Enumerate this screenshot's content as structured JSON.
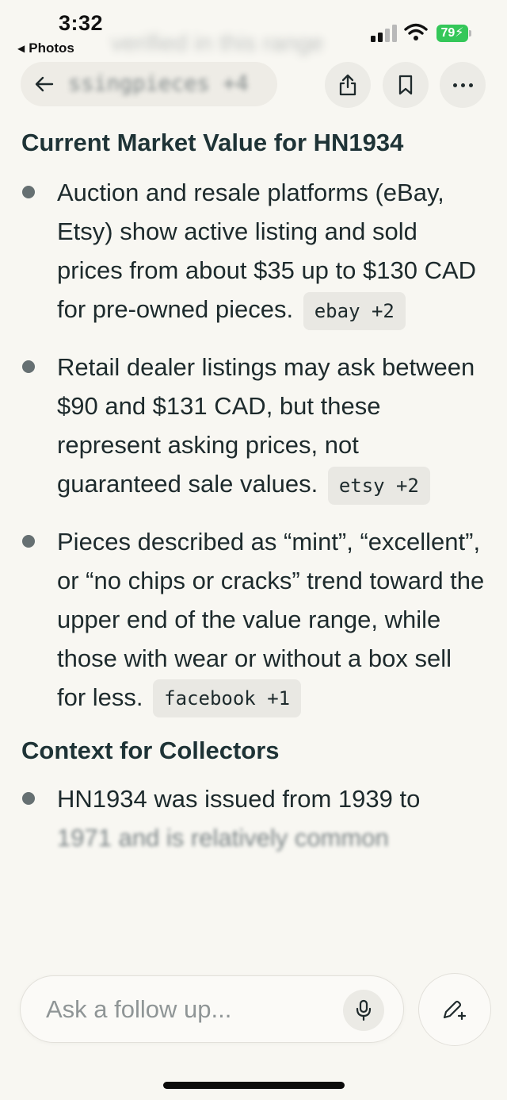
{
  "status_bar": {
    "time": "3:32",
    "back_app": "Photos",
    "battery": "79",
    "battery_color": "#34c759"
  },
  "header": {
    "ghost_text": "verified in this range",
    "title_blurred": "ssingpieces +4",
    "icons": [
      "arrow-left-icon",
      "share-icon",
      "bookmark-icon",
      "more-icon"
    ]
  },
  "content": {
    "heading1": "Current Market Value for HN1934",
    "bullets": [
      {
        "text": "Auction and resale platforms (eBay, Etsy) show active listing and sold prices from about $35 up to $130 CAD for pre-owned pieces.",
        "citation": "ebay +2"
      },
      {
        "text": "Retail dealer listings may ask between $90 and $131 CAD, but these represent asking prices, not guaranteed sale values.",
        "citation": "etsy +2"
      },
      {
        "text": "Pieces described as “mint”, “excellent”, or “no chips or cracks” trend toward the upper end of the value range, while those with wear or without a box sell for less.",
        "citation": "facebook +1"
      }
    ],
    "heading2": "Context for Collectors",
    "bullets2": [
      {
        "text": "HN1934 was issued from 1939 to"
      },
      {
        "text": "1971 and is relatively common"
      }
    ]
  },
  "composer": {
    "placeholder": "Ask a follow up...",
    "icons": [
      "microphone-icon",
      "new-thread-icon"
    ]
  }
}
